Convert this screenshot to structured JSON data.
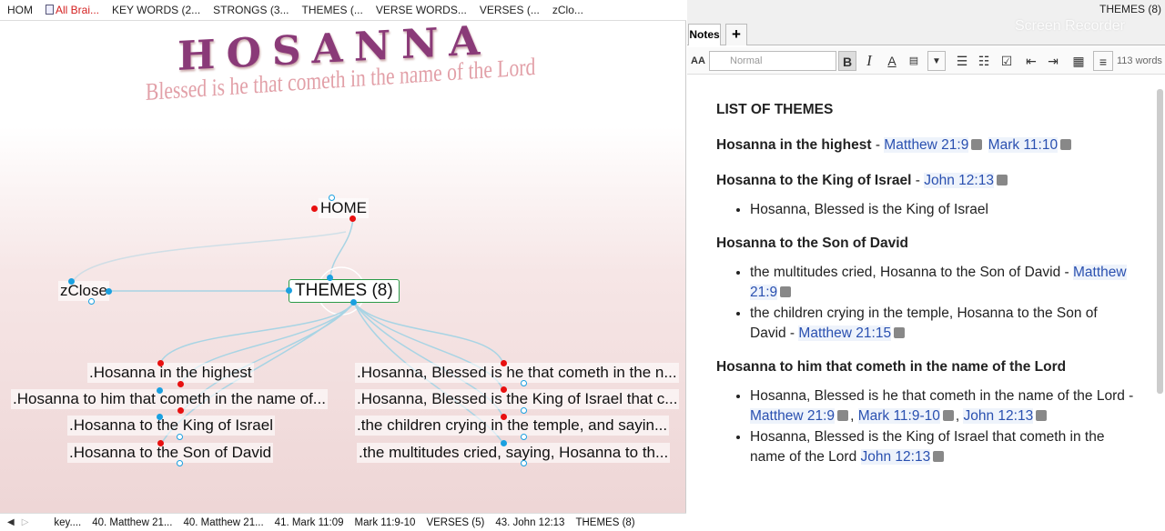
{
  "left_tabs": [
    "HOM",
    "All Brai...",
    "KEY WORDS (2...",
    "STRONGS (3...",
    "THEMES (...",
    "VERSE WORDS...",
    "VERSES (...",
    "zClo..."
  ],
  "banner": {
    "title": "HOSANNA",
    "subtitle": "Blessed is he that cometh in the name of the Lord"
  },
  "graph": {
    "home": "HOME",
    "center": "THEMES (8)",
    "side": "zClose",
    "children_left": [
      ".Hosanna in the highest",
      ".Hosanna to him that cometh in the name of...",
      ".Hosanna to the King of Israel",
      ".Hosanna to the Son of David"
    ],
    "children_right": [
      ".Hosanna, Blessed is he that cometh in the n...",
      ".Hosanna, Blessed is the King of Israel that c...",
      ".the children crying in the temple, and sayin...",
      ".the multitudes cried, saying, Hosanna to th..."
    ]
  },
  "bottom_tabs": [
    "key....",
    "40. Matthew 21...",
    "40. Matthew 21...",
    "41. Mark 11:09",
    "Mark 11:9-10",
    "VERSES (5)",
    "43. John 12:13",
    "THEMES (8)"
  ],
  "right": {
    "title": "THEMES (8)",
    "tab": "Notes",
    "add_tab": "+",
    "watermark": "Screen Recorder",
    "toolbar": {
      "font_size": "AA",
      "style": "Normal",
      "bold": "B",
      "italic": "I",
      "word_count": "113 words"
    },
    "notes": {
      "heading": "LIST OF THEMES",
      "t1": "Hosanna in the highest",
      "t1_sep": " - ",
      "t1_l1": "Matthew 21:9",
      "t1_l2": "Mark 11:10",
      "t2": "Hosanna to the King of Israel",
      "t2_sep": " - ",
      "t2_l1": "John 12:13",
      "t2_b1": "Hosanna, Blessed is the King of Israel",
      "t3": "Hosanna to the Son of David",
      "t3_b1": "the multitudes cried, Hosanna to the Son of David - ",
      "t3_b1_l": "Matthew 21:9",
      "t3_b2": "the children crying in the temple, Hosanna to the Son of David - ",
      "t3_b2_l": "Matthew 21:15",
      "t4": "Hosanna to him that cometh in the name of the Lord",
      "t4_b1": "Hosanna, Blessed is he that cometh in the name of the Lord - ",
      "t4_b1_l1": "Matthew 21:9",
      "t4_b1_l2": "Mark 11:9-10",
      "t4_b1_l3": "John 12:13",
      "t4_b2": "Hosanna, Blessed is the King of Israel that cometh in the name of the Lord ",
      "t4_b2_l": "John 12:13"
    }
  }
}
